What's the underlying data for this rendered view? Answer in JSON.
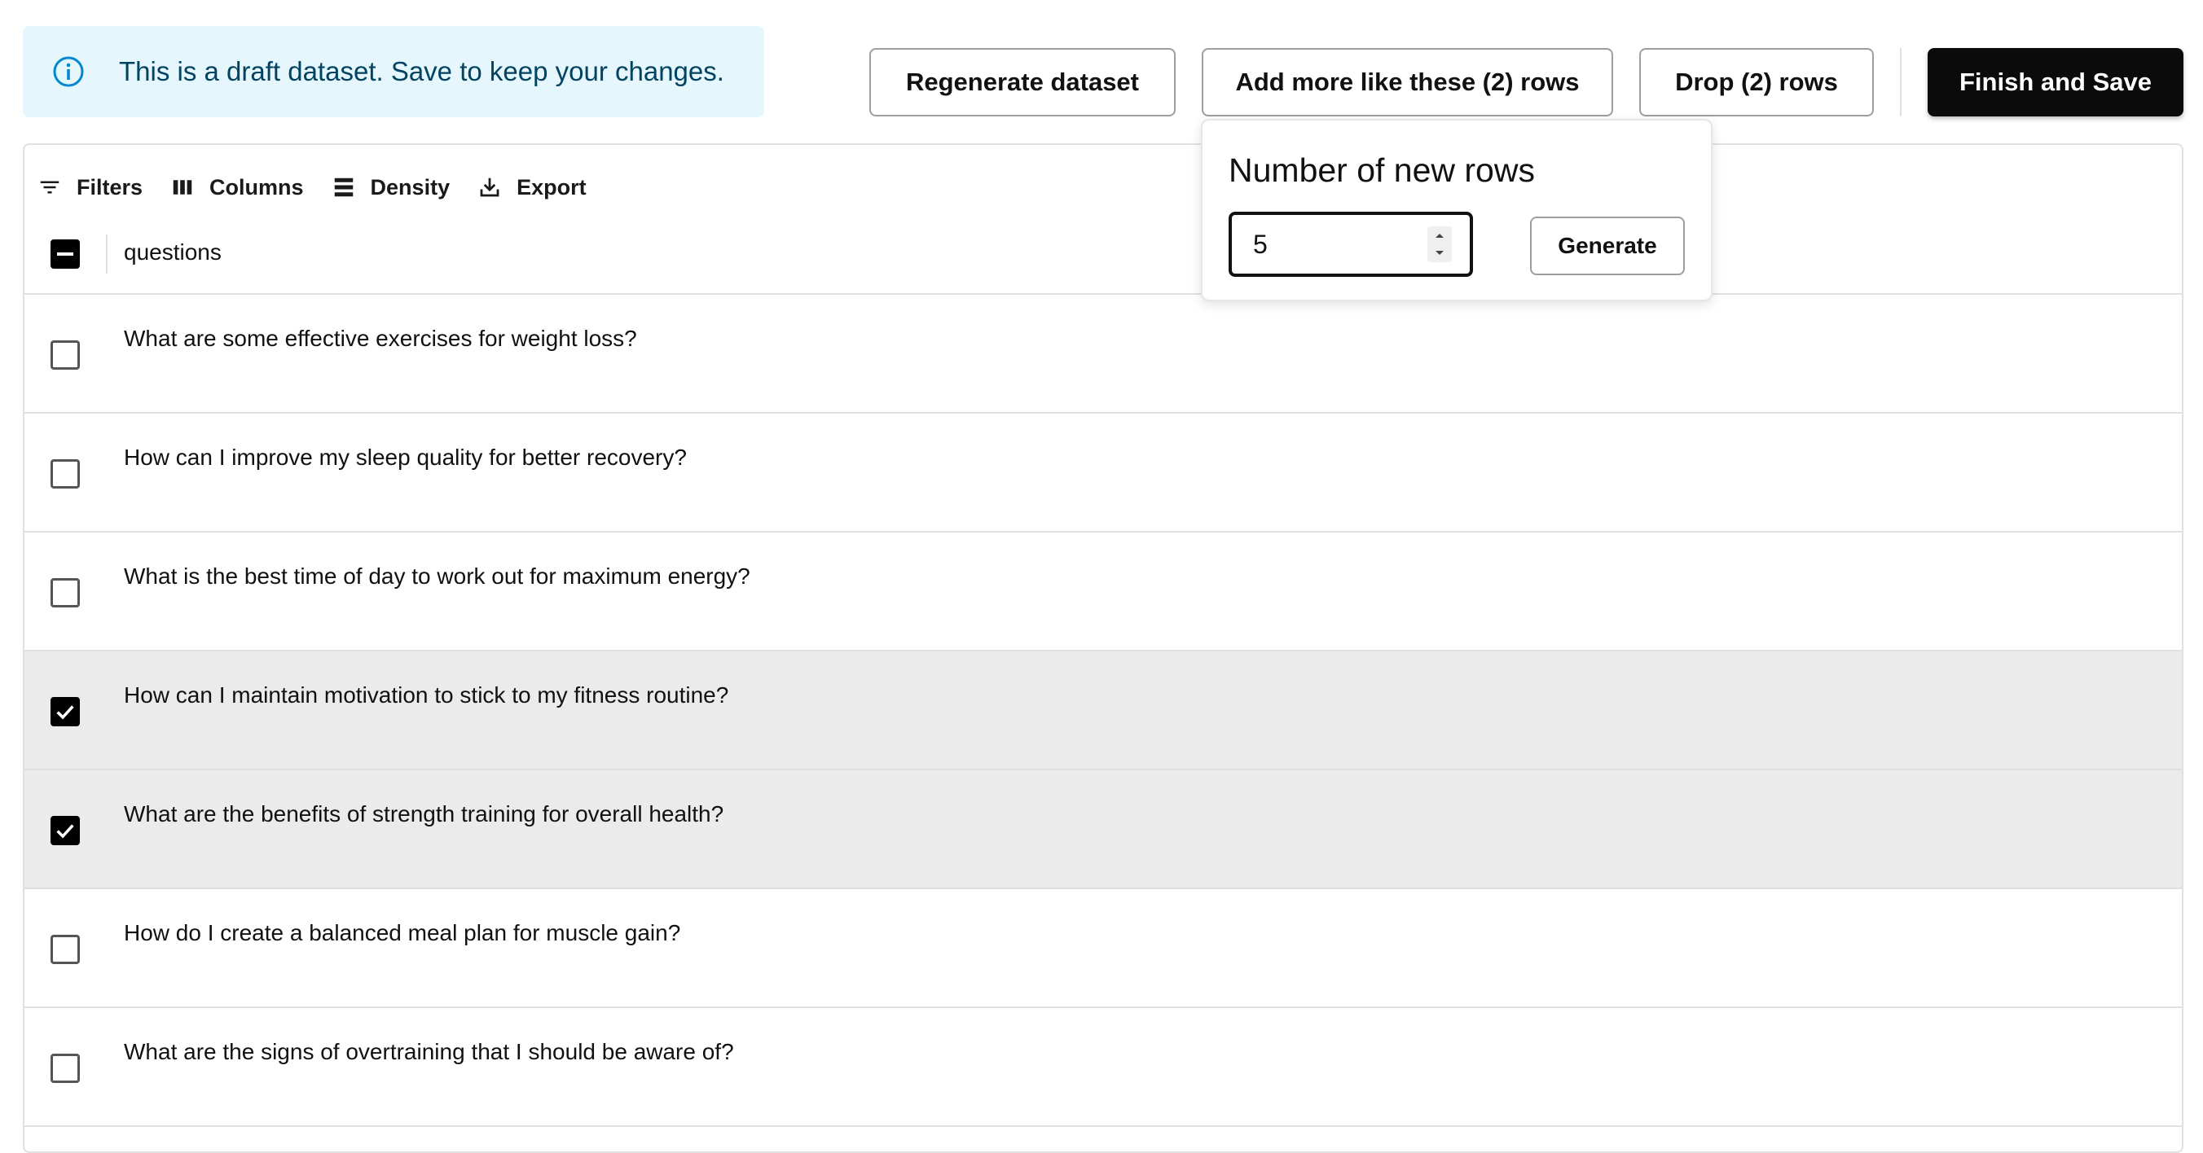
{
  "alert": {
    "icon": "info-icon",
    "message": "This is a draft dataset. Save to keep your changes."
  },
  "toolbar": {
    "regenerate_label": "Regenerate dataset",
    "add_more_label": "Add more like these (2) rows",
    "drop_label": "Drop (2) rows",
    "finish_label": "Finish and Save"
  },
  "grid_toolbar": {
    "filters": "Filters",
    "columns": "Columns",
    "density": "Density",
    "export": "Export"
  },
  "grid": {
    "column_header": "questions",
    "header_checkbox_state": "indeterminate",
    "rows": [
      {
        "question": "What are some effective exercises for weight loss?",
        "selected": false
      },
      {
        "question": "How can I improve my sleep quality for better recovery?",
        "selected": false
      },
      {
        "question": "What is the best time of day to work out for maximum energy?",
        "selected": false
      },
      {
        "question": "How can I maintain motivation to stick to my fitness routine?",
        "selected": true
      },
      {
        "question": "What are the benefits of strength training for overall health?",
        "selected": true
      },
      {
        "question": "How do I create a balanced meal plan for muscle gain?",
        "selected": false
      },
      {
        "question": "What are the signs of overtraining that I should be aware of?",
        "selected": false
      }
    ]
  },
  "popover": {
    "title": "Number of new rows",
    "input_value": "5",
    "generate_label": "Generate"
  },
  "colors": {
    "alert_bg": "#e5f6fd",
    "alert_text": "#014361",
    "primary_button": "#0b0b0b",
    "selected_row_bg": "#ebebeb"
  }
}
